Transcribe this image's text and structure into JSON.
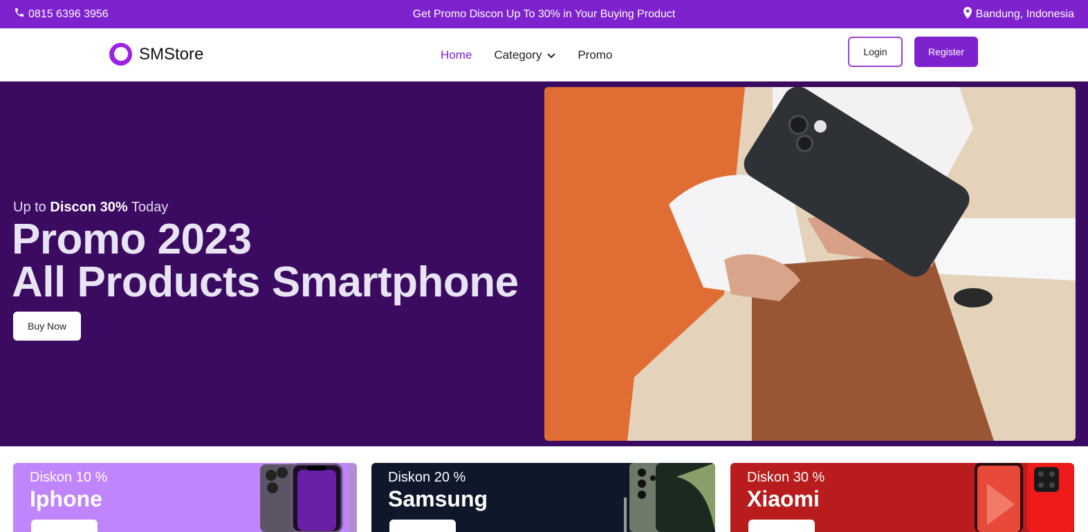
{
  "topbar": {
    "phone": "0815 6396 3956",
    "promo": "Get Promo Discon Up To 30% in Your Buying Product",
    "location": "Bandung, Indonesia"
  },
  "navbar": {
    "brand": "SMStore",
    "menu": [
      {
        "label": "Home",
        "active": true
      },
      {
        "label": "Category",
        "active": false
      },
      {
        "label": "Promo",
        "active": false
      }
    ],
    "login": "Login",
    "register": "Register"
  },
  "hero": {
    "subtitle_prefix": "Up to",
    "subtitle_bold": "Discon 30%",
    "subtitle_suffix": "Today",
    "title_line1": "Promo 2023",
    "title_line2": "All Products Smartphone",
    "button": "Buy Now"
  },
  "cards": [
    {
      "discount": "Diskon 10 %",
      "brand": "Iphone",
      "color": "#c084fc"
    },
    {
      "discount": "Diskon 20 %",
      "brand": "Samsung",
      "color": "#0f172a"
    },
    {
      "discount": "Diskon 30 %",
      "brand": "Xiaomi",
      "color": "#b91c1c"
    }
  ],
  "colors": {
    "accent": "#7e22ce",
    "hero_bg": "#3a0b60"
  }
}
